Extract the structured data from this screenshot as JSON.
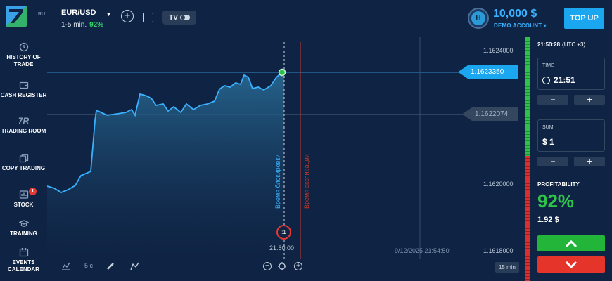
{
  "header": {
    "logo_sup": "RU",
    "asset_name": "EUR/USD",
    "asset_duration": "1-5 min.",
    "asset_payout": "92%",
    "tv_label": "TV",
    "account_initial": "H",
    "balance": "10,000 $",
    "account_type": "DEMO ACCOUNT ▾",
    "topup_label": "TOP UP"
  },
  "sidebar": {
    "items": [
      {
        "label": "HISTORY OF TRADE",
        "icon": "history-icon"
      },
      {
        "label": "CASH REGISTER",
        "icon": "wallet-icon"
      },
      {
        "label": "TRADING ROOM",
        "icon": "trading-room-icon",
        "glyph": "7R"
      },
      {
        "label": "COPY TRADING",
        "icon": "copy-icon"
      },
      {
        "label": "STOCK",
        "icon": "stock-icon",
        "badge": "1"
      },
      {
        "label": "TRAINING",
        "icon": "training-icon"
      },
      {
        "label": "EVENTS CALENDAR",
        "icon": "calendar-icon"
      }
    ]
  },
  "chart": {
    "current_price": "1.1623350",
    "open_price": "1.1622074",
    "axis_prices": [
      "1.1624000",
      "1.1620000",
      "1.1618000"
    ],
    "countdown": ":1",
    "time_label": "21:50:00",
    "date_label": "9/12/2025 21:54:50",
    "lock_label": "Время блокировки",
    "expiry_label": "Время экспирации",
    "range_label": "15 min",
    "tools": {
      "candle_label": "5 c"
    },
    "colors": {
      "line": "#39b1ff",
      "lock_line": "#cfd8e3",
      "expiry_line": "#c0392b"
    }
  },
  "panel": {
    "clock": "21:50:28",
    "timezone": "(UTC +3)",
    "time_label": "TIME",
    "time_value": "21:51",
    "sum_label": "SUM",
    "sum_value": "$ 1",
    "minus": "−",
    "plus": "+",
    "profit_label": "PROFITABILITY",
    "profit_pct": "92%",
    "profit_amount": "1.92 $",
    "colors": {
      "up": "#23b53a",
      "down": "#e5342a"
    }
  }
}
